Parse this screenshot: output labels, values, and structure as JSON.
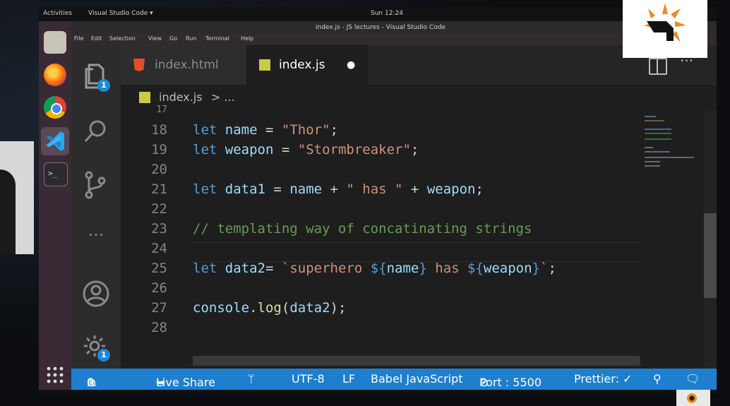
{
  "os": {
    "topbar": {
      "activities": "Activities",
      "app_menu": "Visual Studio Code ▾",
      "clock": "Sun 12:24"
    },
    "window_title": "index.js - JS lectures - Visual Studio Code"
  },
  "menu": [
    "File",
    "Edit",
    "Selection",
    "View",
    "Go",
    "Run",
    "Terminal",
    "Help"
  ],
  "activity_bar": {
    "explorer_badge": "1",
    "settings_badge": "1"
  },
  "tabs": [
    {
      "label": "index.html",
      "icon": "html5-icon",
      "active": false
    },
    {
      "label": "index.js",
      "icon": "js-icon",
      "active": true,
      "modified_dot": "●"
    }
  ],
  "breadcrumb": {
    "file": "index.js",
    "rest": "> ..."
  },
  "editor": {
    "partial_line": "17",
    "lines": [
      {
        "n": "18",
        "text": "let name = \"Thor\";"
      },
      {
        "n": "19",
        "text": "let weapon = \"Stormbreaker\";"
      },
      {
        "n": "20",
        "text": ""
      },
      {
        "n": "21",
        "text": "let data1 = name + \" has \" + weapon;"
      },
      {
        "n": "22",
        "text": ""
      },
      {
        "n": "23",
        "text": "// templating way of concatinating strings"
      },
      {
        "n": "24",
        "text": ""
      },
      {
        "n": "25",
        "text": "let data2= `superhero ${name} has ${weapon}`;"
      },
      {
        "n": "26",
        "text": ""
      },
      {
        "n": "27",
        "text": "console.log(data2);"
      },
      {
        "n": "28",
        "text": ""
      }
    ]
  },
  "statusbar": {
    "errors": "0",
    "warnings": "0",
    "live_share": "Live Share",
    "encoding": "UTF-8",
    "eol": "LF",
    "language": "Babel JavaScript",
    "port": "Port : 5500",
    "prettier": "Prettier: ✓"
  },
  "colors": {
    "statusbar": "#1e7fcf",
    "badge": "#1e8ad6",
    "keyword": "#569cd6",
    "string": "#ce9178",
    "comment": "#6a9955"
  }
}
